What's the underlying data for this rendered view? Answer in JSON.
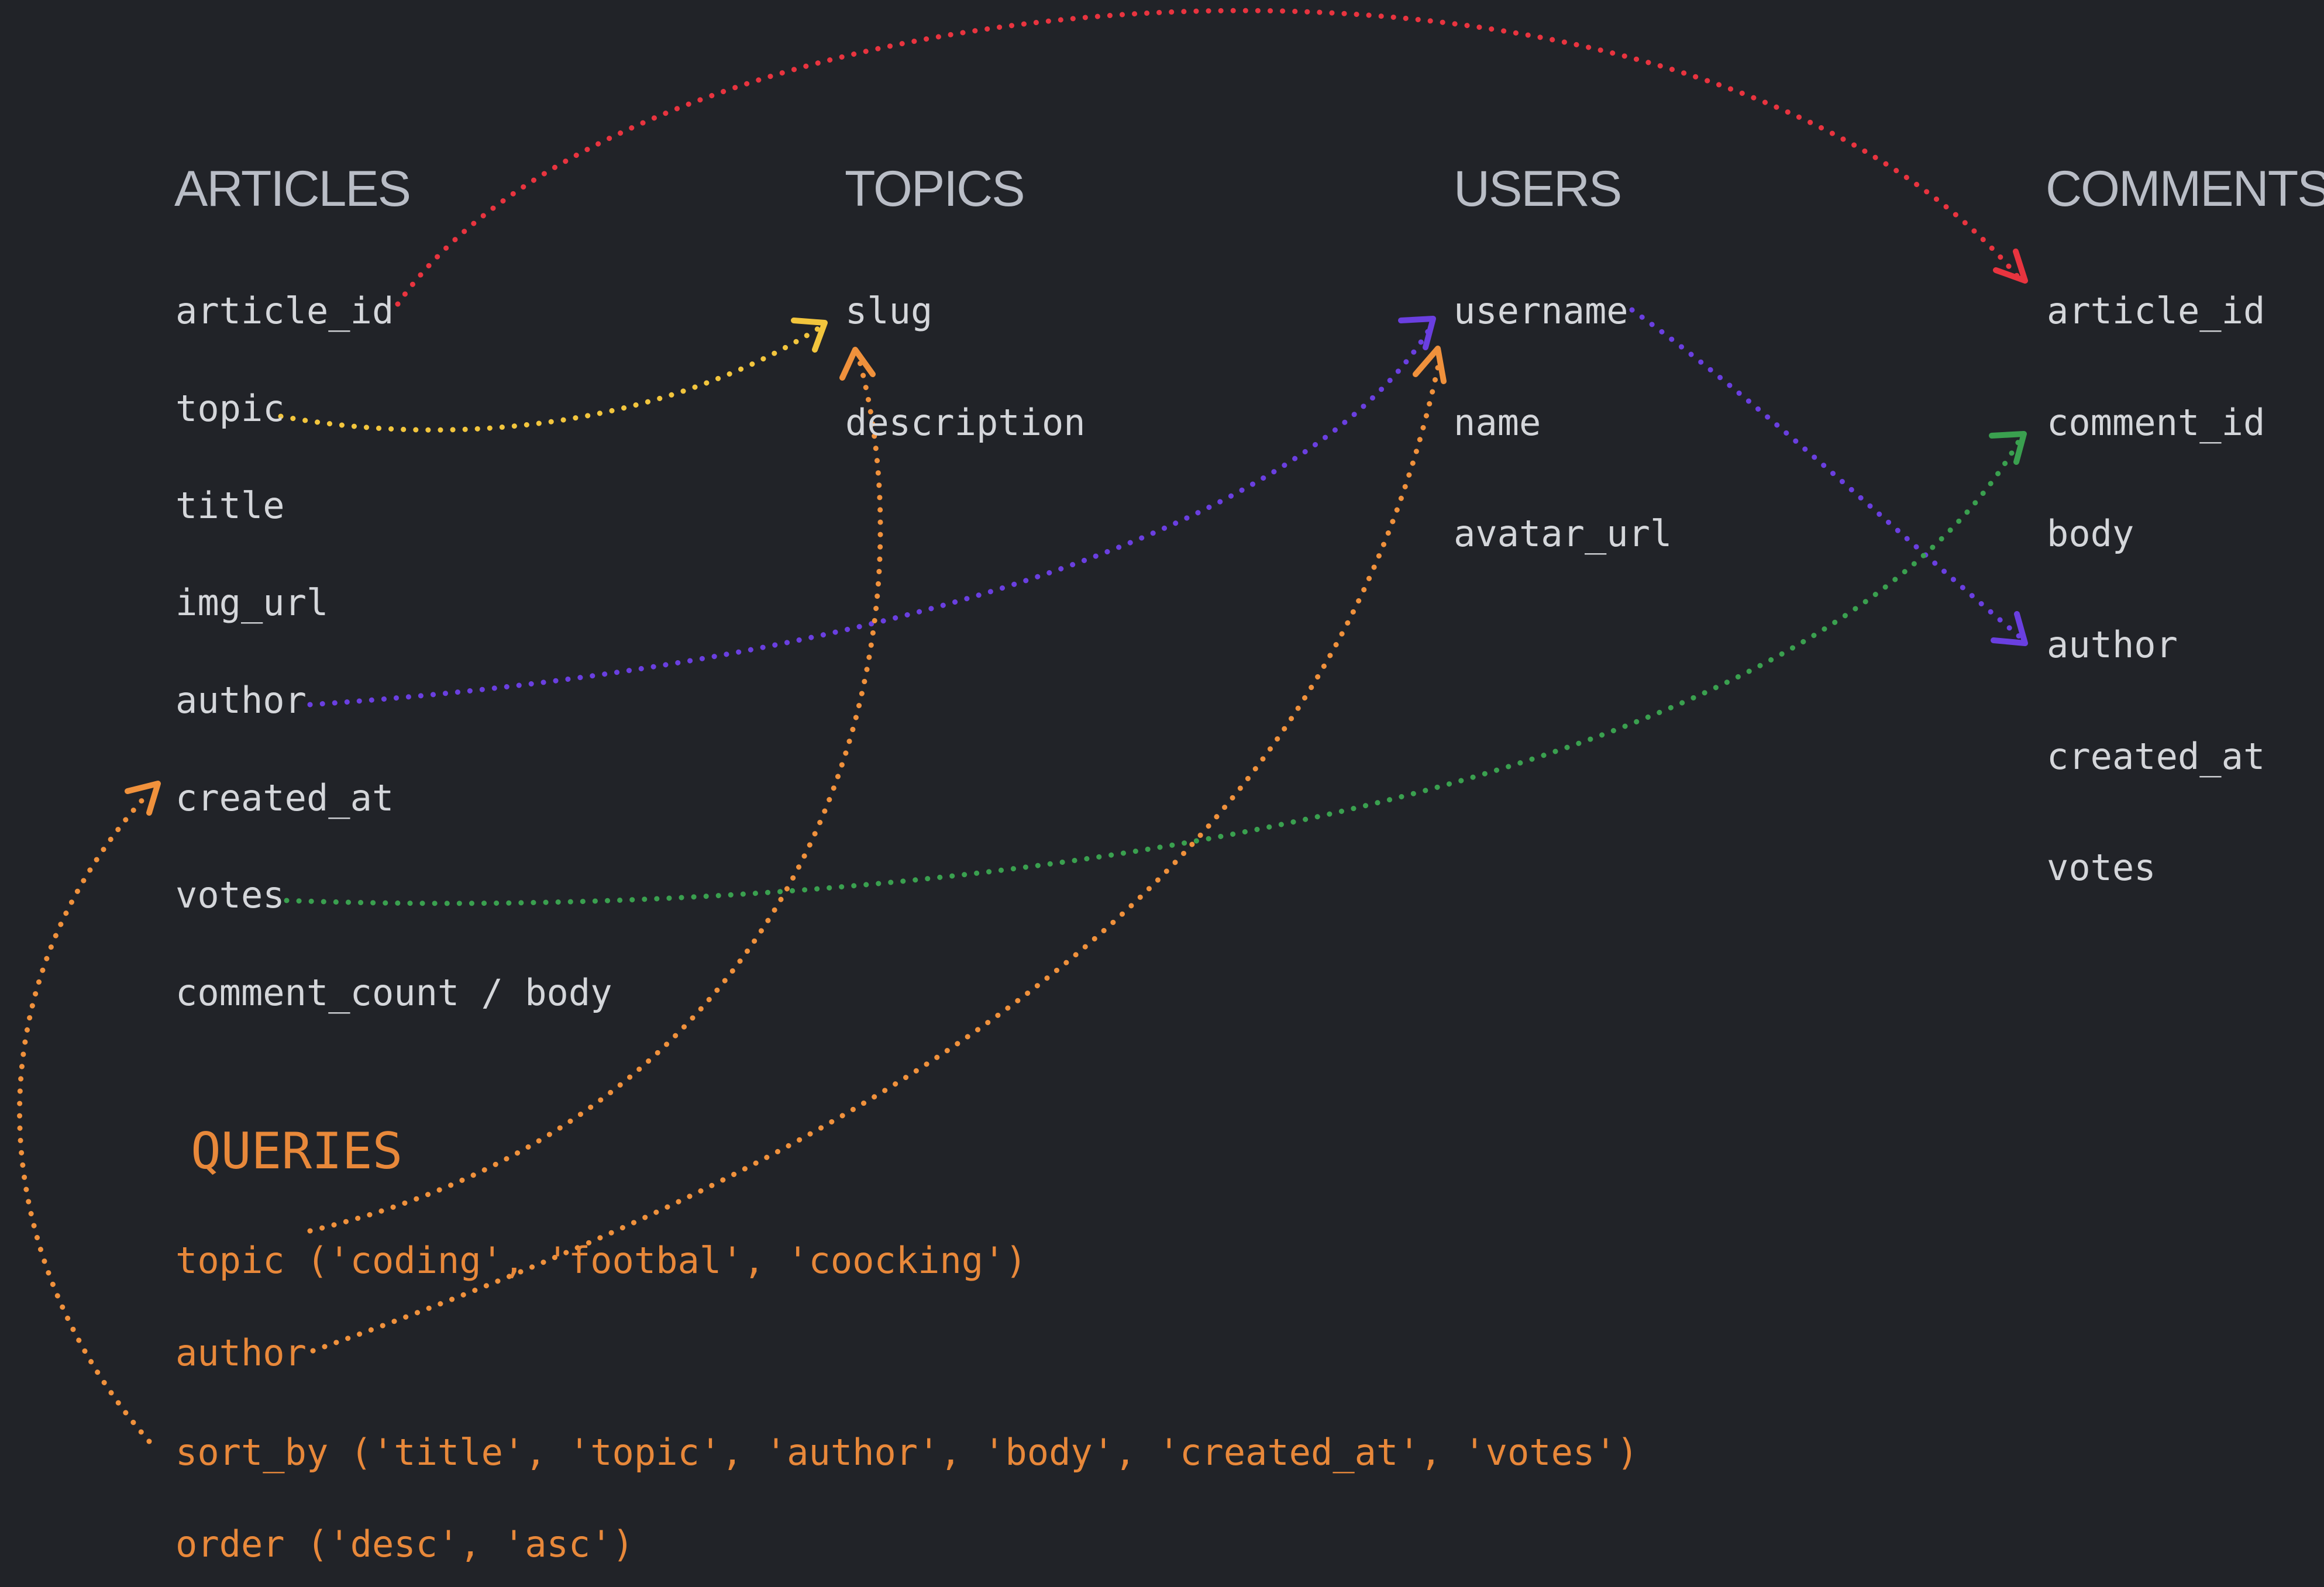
{
  "tables": {
    "articles": {
      "title": "ARTICLES",
      "fields": [
        "article_id",
        "topic",
        "title",
        "img_url",
        "author",
        "created_at",
        "votes",
        "comment_count / body"
      ]
    },
    "topics": {
      "title": "TOPICS",
      "fields": [
        "slug",
        "description"
      ]
    },
    "users": {
      "title": "USERS",
      "fields": [
        "username",
        "name",
        "avatar_url"
      ]
    },
    "comments": {
      "title": "COMMENTS",
      "fields": [
        "article_id",
        "comment_id",
        "body",
        "author",
        "created_at",
        "votes"
      ]
    }
  },
  "queries": {
    "title": "QUERIES",
    "lines": [
      "topic ('coding', 'footbal', 'coocking')",
      "author",
      "sort_by ('title', 'topic', 'author', 'body', 'created_at', 'votes')",
      "order ('desc', 'asc')"
    ]
  },
  "colors": {
    "background": "#212328",
    "heading": "#b9bdc6",
    "field_text": "#d4d6da",
    "query_text": "#e8883a",
    "red_link": "#e8343f",
    "yellow_link": "#f2c53d",
    "purple_link": "#6a3fe0",
    "green_link": "#3aa04f",
    "orange_link": "#f0913c"
  },
  "links": [
    {
      "from": "articles.article_id",
      "to": "comments.article_id",
      "color": "red"
    },
    {
      "from": "articles.topic",
      "to": "topics.slug",
      "color": "yellow"
    },
    {
      "from": "articles.author",
      "to": "users.username",
      "color": "purple"
    },
    {
      "from": "articles.votes",
      "to": "comments.comment_id",
      "color": "green"
    },
    {
      "from": "users.username",
      "to": "comments.author",
      "color": "purple"
    },
    {
      "from": "queries.topic",
      "to": "topics.slug",
      "color": "orange"
    },
    {
      "from": "queries.author",
      "to": "users.username",
      "color": "orange"
    },
    {
      "from": "queries.sort_by",
      "to": "articles.created_at",
      "color": "orange"
    }
  ]
}
